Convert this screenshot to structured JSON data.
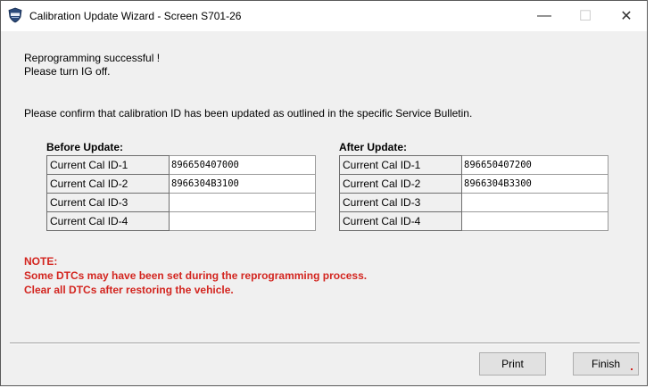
{
  "window": {
    "title": "Calibration Update Wizard - Screen S701-26",
    "controls": {
      "minimize": "—",
      "maximize": "☐",
      "close": "✕"
    }
  },
  "message": {
    "line1": "Reprogramming successful !",
    "line2": "Please turn IG off.",
    "confirm": "Please confirm that calibration ID has been updated as outlined in the specific Service Bulletin."
  },
  "before": {
    "title": "Before Update:",
    "rows": [
      {
        "label": "Current Cal ID-1",
        "value": "896650407000"
      },
      {
        "label": "Current Cal ID-2",
        "value": "8966304B3100"
      },
      {
        "label": "Current Cal ID-3",
        "value": ""
      },
      {
        "label": "Current Cal ID-4",
        "value": ""
      }
    ]
  },
  "after": {
    "title": "After Update:",
    "rows": [
      {
        "label": "Current Cal ID-1",
        "value": "896650407200"
      },
      {
        "label": "Current Cal ID-2",
        "value": "8966304B3300"
      },
      {
        "label": "Current Cal ID-3",
        "value": ""
      },
      {
        "label": "Current Cal ID-4",
        "value": ""
      }
    ]
  },
  "note": {
    "heading": "NOTE:",
    "line1": " Some DTCs may have been set during the reprogramming process.",
    "line2": " Clear all DTCs after restoring the vehicle."
  },
  "buttons": {
    "print": "Print",
    "finish": "Finish"
  },
  "colors": {
    "note_red": "#d3251f",
    "dialog_bg": "#f0f0f0",
    "icon_blue": "#2b4a7a"
  }
}
